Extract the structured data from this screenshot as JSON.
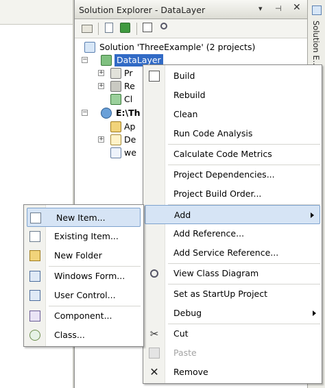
{
  "window": {
    "title": "Solution Explorer - DataLayer",
    "side_tab": "Solution E..."
  },
  "tree": {
    "solution": "Solution 'ThreeExample' (2 projects)",
    "project_selected": "DataLayer",
    "child1": "Pr",
    "child2": "Re",
    "child3": "Cl",
    "project2": "E:\\Th",
    "p2_child1": "Ap",
    "p2_child2": "De",
    "p2_child3": "we"
  },
  "context_menu": {
    "items": [
      {
        "label": "Build"
      },
      {
        "label": "Rebuild"
      },
      {
        "label": "Clean"
      },
      {
        "label": "Run Code Analysis"
      },
      {
        "label": "Calculate Code Metrics"
      },
      {
        "label": "Project Dependencies..."
      },
      {
        "label": "Project Build Order..."
      },
      {
        "label": "Add"
      },
      {
        "label": "Add Reference..."
      },
      {
        "label": "Add Service Reference..."
      },
      {
        "label": "View Class Diagram"
      },
      {
        "label": "Set as StartUp Project"
      },
      {
        "label": "Debug"
      },
      {
        "label": "Cut"
      },
      {
        "label": "Paste"
      },
      {
        "label": "Remove"
      }
    ]
  },
  "add_submenu": {
    "items": [
      {
        "label": "New Item..."
      },
      {
        "label": "Existing Item..."
      },
      {
        "label": "New Folder"
      },
      {
        "label": "Windows Form..."
      },
      {
        "label": "User Control..."
      },
      {
        "label": "Component..."
      },
      {
        "label": "Class..."
      }
    ]
  },
  "colors": {
    "selection": "#316ac5",
    "menu_highlight": "#d6e4f5",
    "menu_highlight_border": "#7da2ce"
  }
}
